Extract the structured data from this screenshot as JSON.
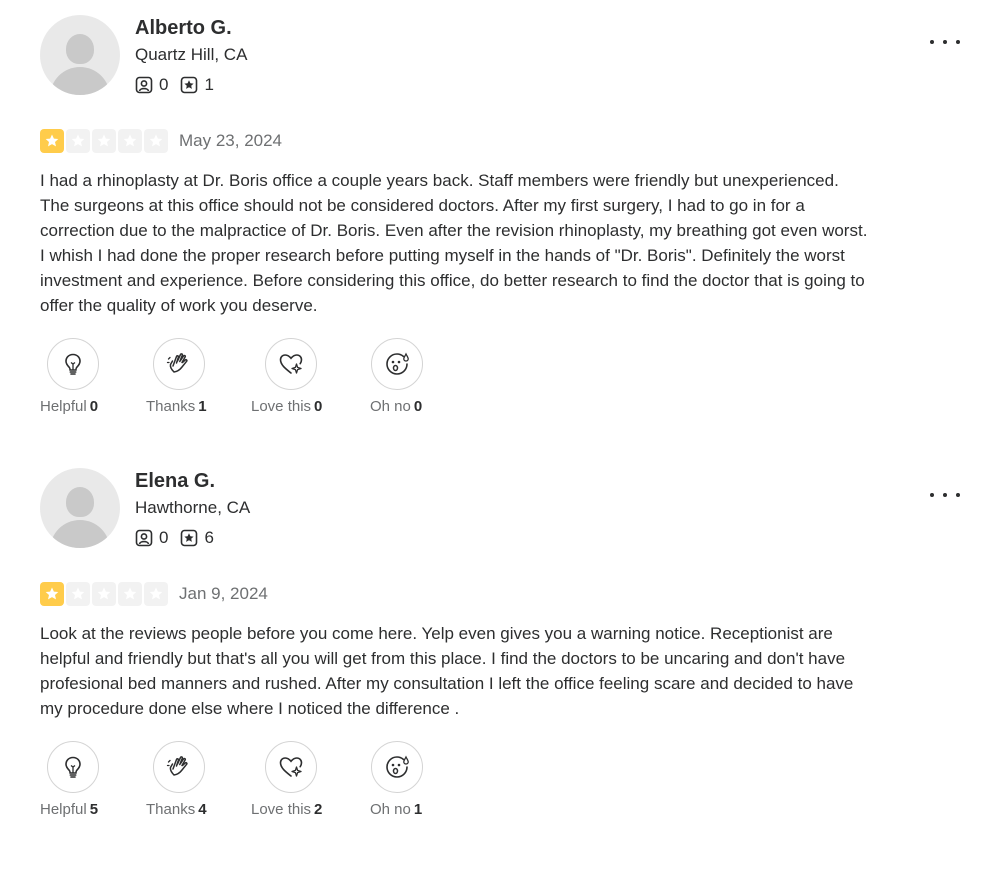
{
  "reviews": [
    {
      "name": "Alberto G.",
      "location": "Quartz Hill, CA",
      "friends": "0",
      "reviews_count": "1",
      "rating": 1,
      "date": "May 23, 2024",
      "text": "I had a rhinoplasty at Dr. Boris office a couple years back. Staff members were friendly but unexperienced. The surgeons at this office should not be considered doctors. After my first surgery, I had to go in for a correction due to the malpractice of Dr. Boris. Even after the revision rhinoplasty, my breathing got even worst. I whish I had done the proper research before putting myself in the hands of \"Dr. Boris\". Definitely the worst investment and experience. Before considering this office, do better research to find the doctor that is going to offer the quality of work you deserve.",
      "reactions": {
        "helpful": {
          "label": "Helpful",
          "count": "0"
        },
        "thanks": {
          "label": "Thanks",
          "count": "1"
        },
        "love": {
          "label": "Love this",
          "count": "0"
        },
        "ohno": {
          "label": "Oh no",
          "count": "0"
        }
      }
    },
    {
      "name": "Elena G.",
      "location": "Hawthorne, CA",
      "friends": "0",
      "reviews_count": "6",
      "rating": 1,
      "date": "Jan 9, 2024",
      "text": "Look at the reviews people before you come here. Yelp even gives you a warning notice. Receptionist are helpful and friendly but that's all you will get from this place. I find the doctors to be uncaring and don't have profesional bed manners and rushed. After my consultation I left the office feeling scare and decided to have my procedure done else where I noticed the difference .",
      "reactions": {
        "helpful": {
          "label": "Helpful",
          "count": "5"
        },
        "thanks": {
          "label": "Thanks",
          "count": "4"
        },
        "love": {
          "label": "Love this",
          "count": "2"
        },
        "ohno": {
          "label": "Oh no",
          "count": "1"
        }
      }
    }
  ],
  "colors": {
    "star_on": "#ffcc4b",
    "star_off": "#f2f2f2",
    "text": "#2d2e2f",
    "muted": "#6e7072"
  },
  "icons": [
    "avatar-placeholder",
    "friends-icon",
    "reviews-icon",
    "more-icon",
    "star-icon",
    "lightbulb-icon",
    "thanks-hand-icon",
    "heart-sparkle-icon",
    "oh-no-face-icon"
  ]
}
